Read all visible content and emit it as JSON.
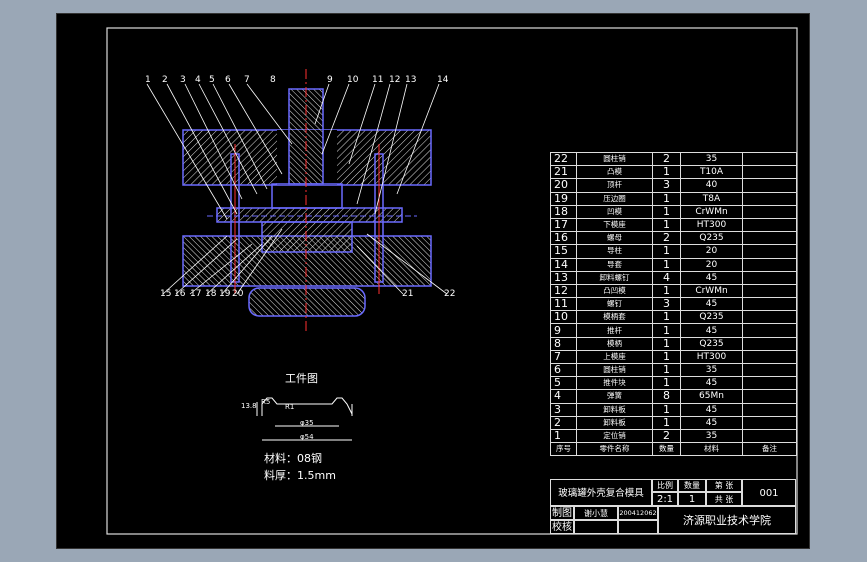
{
  "callouts_top": [
    "1",
    "2",
    "3",
    "4",
    "5",
    "6",
    "7",
    "8",
    "9",
    "10",
    "11",
    "12",
    "13",
    "14"
  ],
  "callouts_bottom": [
    "15",
    "16",
    "17",
    "18",
    "19",
    "20",
    "21",
    "22"
  ],
  "workpiece": {
    "title": "工件图",
    "dims": [
      "13.8",
      "R5",
      "R1",
      "φ35",
      "φ54"
    ],
    "material": "材料：08钢",
    "thickness": "料厚：1.5mm"
  },
  "bom": [
    {
      "no": "22",
      "name": "圆柱销",
      "qty": "2",
      "mat": "35",
      "note": ""
    },
    {
      "no": "21",
      "name": "凸模",
      "qty": "1",
      "mat": "T10A",
      "note": ""
    },
    {
      "no": "20",
      "name": "顶杆",
      "qty": "3",
      "mat": "40",
      "note": ""
    },
    {
      "no": "19",
      "name": "压边圈",
      "qty": "1",
      "mat": "T8A",
      "note": ""
    },
    {
      "no": "18",
      "name": "凹模",
      "qty": "1",
      "mat": "CrWMn",
      "note": ""
    },
    {
      "no": "17",
      "name": "下模座",
      "qty": "1",
      "mat": "HT300",
      "note": ""
    },
    {
      "no": "16",
      "name": "螺母",
      "qty": "2",
      "mat": "Q235",
      "note": ""
    },
    {
      "no": "15",
      "name": "导柱",
      "qty": "1",
      "mat": "20",
      "note": ""
    },
    {
      "no": "14",
      "name": "导套",
      "qty": "1",
      "mat": "20",
      "note": ""
    },
    {
      "no": "13",
      "name": "卸料螺钉",
      "qty": "4",
      "mat": "45",
      "note": ""
    },
    {
      "no": "12",
      "name": "凸凹模",
      "qty": "1",
      "mat": "CrWMn",
      "note": ""
    },
    {
      "no": "11",
      "name": "螺钉",
      "qty": "3",
      "mat": "45",
      "note": ""
    },
    {
      "no": "10",
      "name": "模柄套",
      "qty": "1",
      "mat": "Q235",
      "note": ""
    },
    {
      "no": "9",
      "name": "推杆",
      "qty": "1",
      "mat": "45",
      "note": ""
    },
    {
      "no": "8",
      "name": "模柄",
      "qty": "1",
      "mat": "Q235",
      "note": ""
    },
    {
      "no": "7",
      "name": "上模座",
      "qty": "1",
      "mat": "HT300",
      "note": ""
    },
    {
      "no": "6",
      "name": "圆柱销",
      "qty": "1",
      "mat": "35",
      "note": ""
    },
    {
      "no": "5",
      "name": "推件块",
      "qty": "1",
      "mat": "45",
      "note": ""
    },
    {
      "no": "4",
      "name": "弹簧",
      "qty": "8",
      "mat": "65Mn",
      "note": ""
    },
    {
      "no": "3",
      "name": "卸料板",
      "qty": "1",
      "mat": "45",
      "note": ""
    },
    {
      "no": "2",
      "name": "卸料板",
      "qty": "1",
      "mat": "45",
      "note": ""
    },
    {
      "no": "1",
      "name": "定位销",
      "qty": "2",
      "mat": "35",
      "note": ""
    }
  ],
  "bom_header": {
    "no": "序号",
    "name": "零件名称",
    "qty": "数量",
    "mat": "材料",
    "note": "备注"
  },
  "titleblock": {
    "title": "玻璃罐外壳复合模具",
    "scale_label": "比例",
    "scale": "2:1",
    "qty_label": "数量",
    "qty": "1",
    "sheet_label": "第 张",
    "total_label": "共 张",
    "code": "001",
    "drawn_label": "制图",
    "drawn_by": "谢小慧",
    "id": "200412062",
    "checked_label": "校核",
    "school": "济源职业技术学院"
  }
}
